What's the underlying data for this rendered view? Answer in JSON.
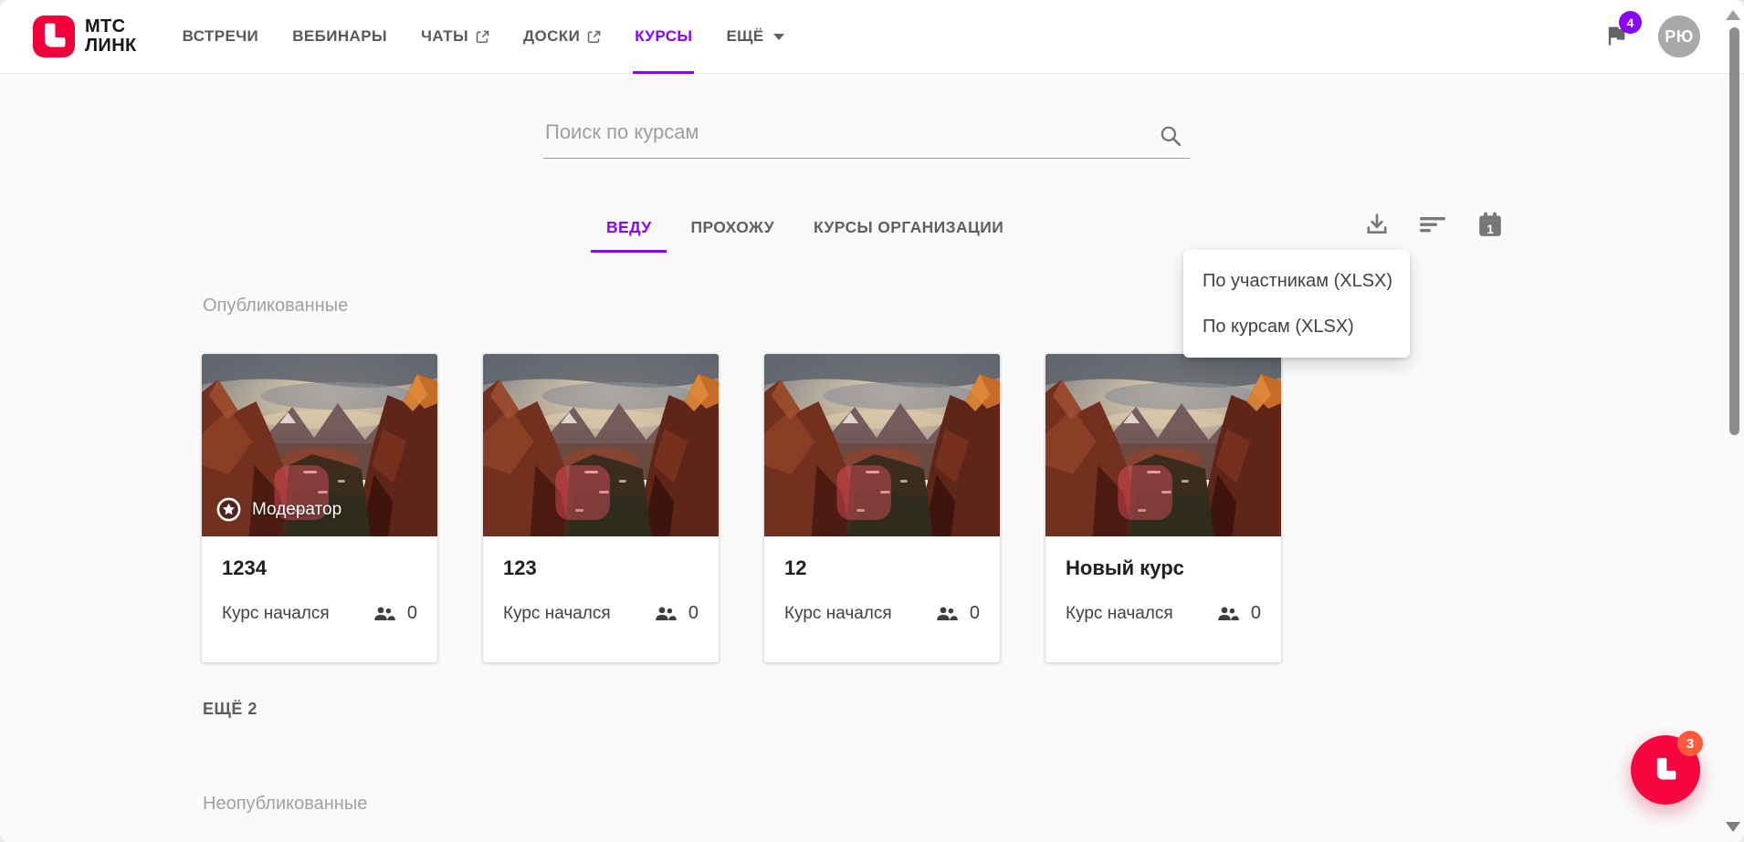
{
  "brand": {
    "line1": "МТС",
    "line2": "ЛИНК"
  },
  "header": {
    "nav": [
      {
        "label": "ВСТРЕЧИ"
      },
      {
        "label": "ВЕБИНАРЫ"
      },
      {
        "label": "ЧАТЫ",
        "external": true
      },
      {
        "label": "ДОСКИ",
        "external": true
      },
      {
        "label": "КУРСЫ",
        "active": true
      },
      {
        "label": "ЕЩЁ",
        "has_dropdown": true
      }
    ],
    "notifications_count": "4",
    "avatar_initials": "РЮ"
  },
  "search": {
    "placeholder": "Поиск по курсам"
  },
  "tabs": [
    {
      "label": "ВЕДУ",
      "active": true
    },
    {
      "label": "ПРОХОЖУ",
      "active": false
    },
    {
      "label": "КУРСЫ ОРГАНИЗАЦИИ",
      "active": false
    }
  ],
  "toolbar": {
    "calendar_badge": "1"
  },
  "export_menu": {
    "items": [
      {
        "label": "По участникам (XLSX)"
      },
      {
        "label": "По курсам (XLSX)"
      }
    ]
  },
  "sections": {
    "published_title": "Опубликованные",
    "more_label": "ЕЩЁ 2",
    "unpublished_title": "Неопубликованные"
  },
  "courses": [
    {
      "title": "1234",
      "status": "Курс начался",
      "participants": "0",
      "role_badge": "Модератор"
    },
    {
      "title": "123",
      "status": "Курс начался",
      "participants": "0"
    },
    {
      "title": "12",
      "status": "Курс начался",
      "participants": "0"
    },
    {
      "title": "Новый курс",
      "status": "Курс начался",
      "participants": "0"
    }
  ],
  "floating_widget": {
    "badge": "3"
  },
  "icons": {
    "mts-link-logo": "rounded red square with white L",
    "external-link": "↗",
    "dropdown-caret": "▾",
    "flag": "⚑",
    "search": "🔍",
    "download": "⤓",
    "sort": "≡",
    "calendar": "📅",
    "moderator-star": "★",
    "people": "👥",
    "scroll-up": "▲",
    "scroll-down": "▼"
  },
  "colors": {
    "accent_purple": "#8A05F5",
    "brand_red": "#F2003B",
    "fab_red": "#F5063F",
    "fab_badge_orange": "#FF5A3C",
    "notification_badge_purple": "#8A05F5",
    "content_background": "#FAFAFA",
    "header_background": "#FFFFFF"
  }
}
